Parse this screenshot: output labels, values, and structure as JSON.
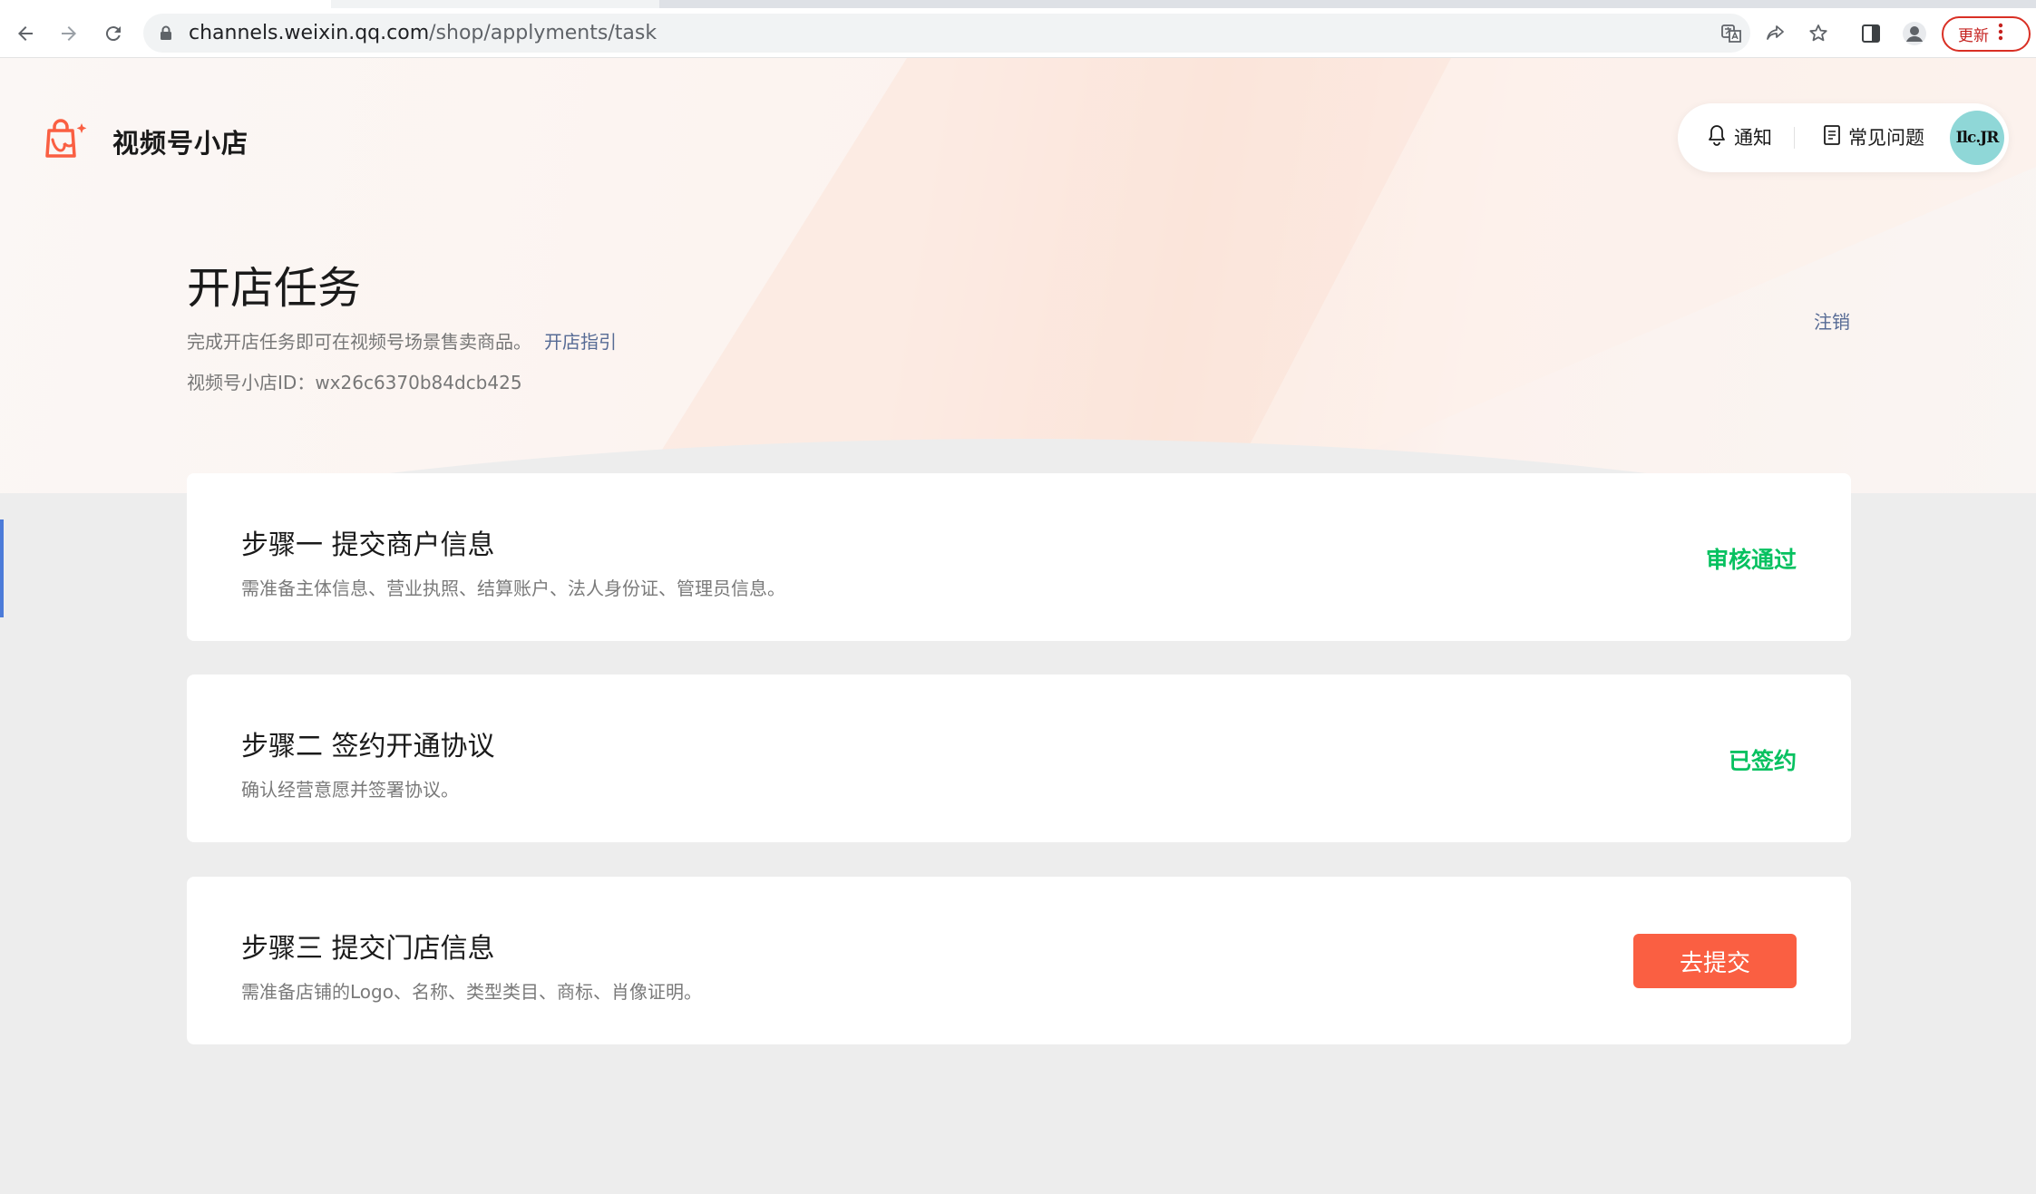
{
  "browser": {
    "url_host": "channels.weixin.qq.com",
    "url_path": "/shop/applyments/task",
    "update_label": "更新"
  },
  "app": {
    "brand_name": "视频号小店"
  },
  "topbar": {
    "notify_label": "通知",
    "faq_label": "常见问题",
    "avatar_text": "Ilc.JR"
  },
  "header": {
    "title": "开店任务",
    "subtitle": "完成开店任务即可在视频号场景售卖商品。",
    "guide_link": "开店指引",
    "shop_id_label": "视频号小店ID：",
    "shop_id_value": "wx26c6370b84dcb425",
    "logout_label": "注销"
  },
  "steps": [
    {
      "title": "步骤一 提交商户信息",
      "desc": "需准备主体信息、营业执照、结算账户、法人身份证、管理员信息。",
      "status": "审核通过"
    },
    {
      "title": "步骤二 签约开通协议",
      "desc": "确认经营意愿并签署协议。",
      "status": "已签约"
    },
    {
      "title": "步骤三 提交门店信息",
      "desc": "需准备店铺的Logo、名称、类型类目、商标、肖像证明。",
      "action": "去提交"
    }
  ],
  "colors": {
    "success": "#07c160",
    "primary_button": "#fa5f42",
    "link": "#576b95",
    "brand_icon": "#fa5f42"
  }
}
